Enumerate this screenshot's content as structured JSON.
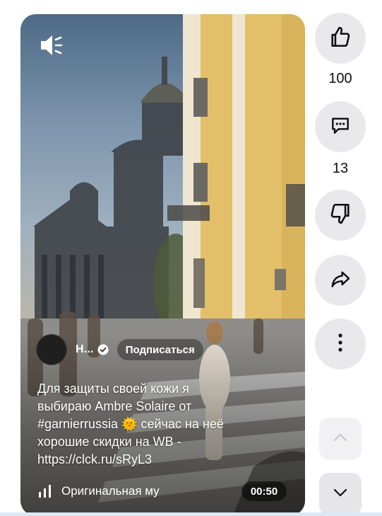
{
  "player": {
    "sound_icon": "sound-on-icon",
    "channel": {
      "name": "Н...",
      "verified_icon": "verified-check-icon",
      "subscribe_label": "Подписаться"
    },
    "caption": "Для защиты своей кожи я\nвыбираю Ambre Solaire от\n#garnierrussia 🌞 сейчас на неё\nхорошие скидки на WB -\nhttps://clck.ru/sRyL3",
    "music": {
      "icon": "music-bars-icon",
      "label": "Оригинальная му"
    },
    "duration": "00:50"
  },
  "actions": {
    "like": {
      "icon": "thumbs-up-icon",
      "count": "100"
    },
    "comments": {
      "icon": "comment-icon",
      "count": "13"
    },
    "dislike": {
      "icon": "thumbs-down-icon"
    },
    "share": {
      "icon": "share-icon"
    },
    "more": {
      "icon": "more-vert-icon"
    }
  },
  "navigation": {
    "prev_icon": "chevron-up-icon",
    "next_icon": "chevron-down-icon"
  },
  "colors": {
    "action_bg": "#e9e9ec",
    "text": "#0f0f0f",
    "overlay_text": "#ffffff"
  }
}
